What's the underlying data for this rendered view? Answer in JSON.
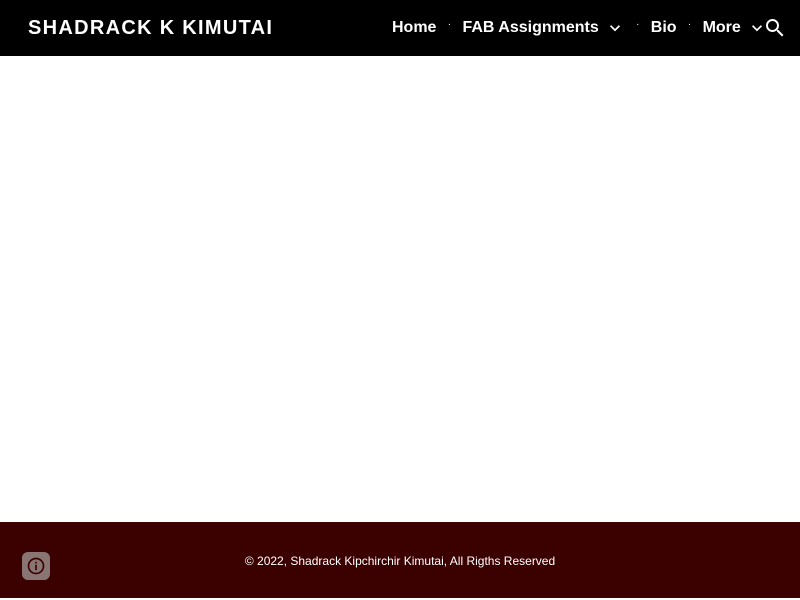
{
  "header": {
    "site_title": "SHADRACK K KIMUTAI",
    "nav": {
      "home": "Home",
      "fab_assignments": "FAB Assignments",
      "bio": "Bio",
      "more": "More",
      "separator": "·"
    },
    "search_icon": "search-icon",
    "dropdown_icon": "chevron-down-icon"
  },
  "footer": {
    "copyright": "© 2022, Shadrack Kipchirchir Kimutai, All Rigths Reserved",
    "info_icon": "info-icon"
  },
  "colors": {
    "header_bg": "#000000",
    "footer_bg": "#3b0000",
    "page_bg": "#ffffff",
    "text_light": "#ffffff"
  }
}
